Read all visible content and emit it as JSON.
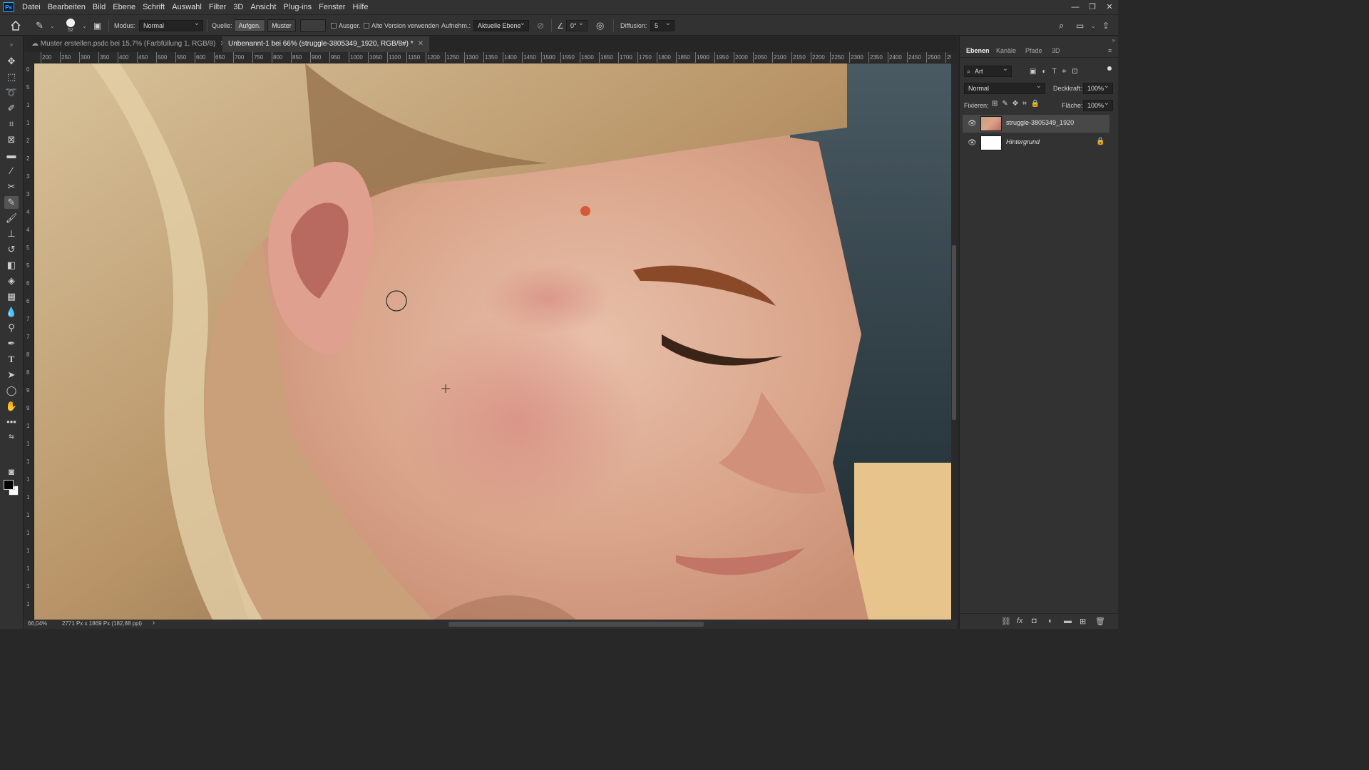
{
  "menu": [
    "Datei",
    "Bearbeiten",
    "Bild",
    "Ebene",
    "Schrift",
    "Auswahl",
    "Filter",
    "3D",
    "Ansicht",
    "Plug-ins",
    "Fenster",
    "Hilfe"
  ],
  "app_logo": "Ps",
  "options": {
    "brush_size": "52",
    "mode_label": "Modus:",
    "mode_value": "Normal",
    "source_label": "Quelle:",
    "source_sampled": "Aufgen.",
    "source_pattern": "Muster",
    "aligned_label": "Ausger.",
    "legacy_label": "Alte Version verwenden",
    "sample_label": "Aufnehm.:",
    "sample_value": "Aktuelle Ebene",
    "angle_value": "0°",
    "diffusion_label": "Diffusion:",
    "diffusion_value": "5"
  },
  "tabs": [
    {
      "label": "Muster erstellen.psdc bei 15,7% (Farbfüllung 1, RGB/8)",
      "active": false
    },
    {
      "label": "Unbenannt-1 bei 66% (struggle-3805349_1920, RGB/8#) *",
      "active": true
    }
  ],
  "ruler_h_labels": [
    "200",
    "250",
    "300",
    "350",
    "400",
    "450",
    "500",
    "550",
    "600",
    "650",
    "700",
    "750",
    "800",
    "850",
    "900",
    "950",
    "1000",
    "1050",
    "1100",
    "1150",
    "1200",
    "1250",
    "1300",
    "1350",
    "1400",
    "1450",
    "1500",
    "1550",
    "1600",
    "1650",
    "1700",
    "1750",
    "1800",
    "1850",
    "1900",
    "1950",
    "2000",
    "2050",
    "2100",
    "2150",
    "2200",
    "2250",
    "2300",
    "2350",
    "2400",
    "2450",
    "2500",
    "25"
  ],
  "ruler_v_labels": [
    "0",
    "5",
    "1",
    "1",
    "2",
    "2",
    "3",
    "3",
    "4",
    "4",
    "5",
    "5",
    "6",
    "6",
    "7",
    "7",
    "8",
    "8",
    "9",
    "9",
    "1",
    "1",
    "1",
    "1",
    "1",
    "1",
    "1",
    "1",
    "1",
    "1",
    "1"
  ],
  "status": {
    "zoom": "66,04%",
    "doc_info": "2771 Px x 1869 Px (182,88 ppi)",
    "arrow": "›"
  },
  "panel": {
    "tabs": [
      "Ebenen",
      "Kanäle",
      "Pfade",
      "3D"
    ],
    "filter_label": "Art",
    "blend_mode": "Normal",
    "opacity_label": "Deckkraft:",
    "opacity_value": "100%",
    "lock_label": "Fixieren:",
    "fill_label": "Fläche:",
    "fill_value": "100%",
    "layers": [
      {
        "name": "struggle-3805349_1920",
        "selected": true,
        "locked": false
      },
      {
        "name": "Hintergrund",
        "selected": false,
        "locked": true
      }
    ]
  },
  "colors": {
    "ui_dark": "#323232",
    "canvas_skin": "#d9a98e",
    "foreground": "#000000",
    "background": "#ffffff"
  }
}
